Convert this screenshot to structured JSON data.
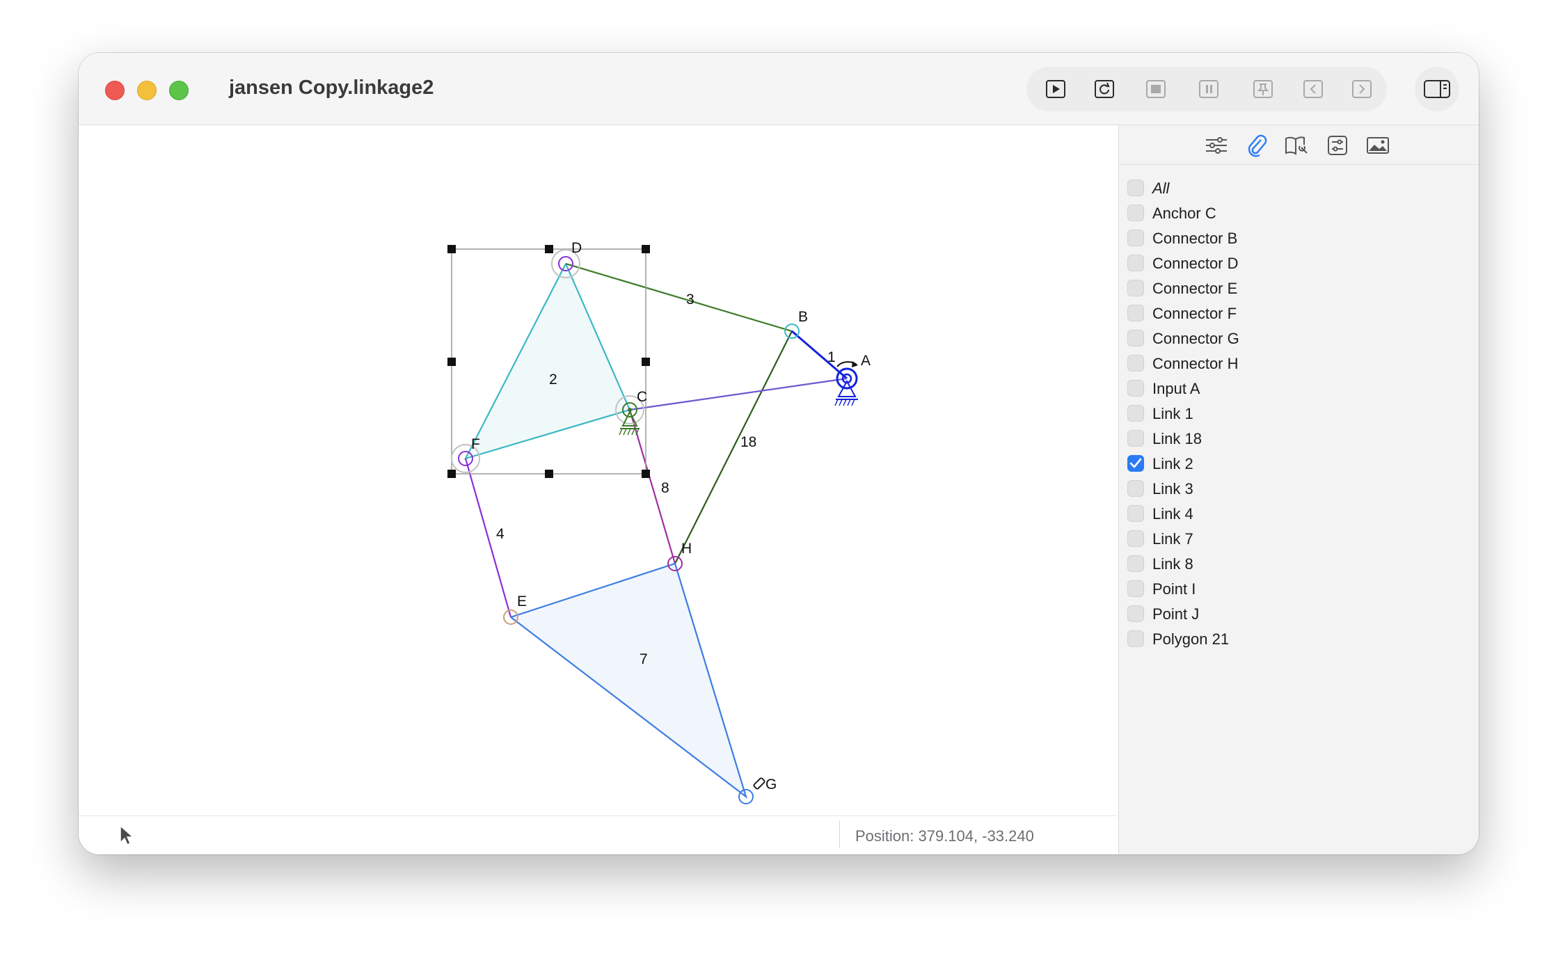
{
  "window": {
    "title": "jansen Copy.linkage2"
  },
  "toolbar": {
    "buttons": [
      {
        "name": "run-button",
        "icon": "play-icon"
      },
      {
        "name": "reset-button",
        "icon": "rotate-icon"
      },
      {
        "name": "stop-button",
        "icon": "stop-icon"
      },
      {
        "name": "pause-button",
        "icon": "pause-icon"
      },
      {
        "name": "pin-button",
        "icon": "pin-icon"
      },
      {
        "name": "step-back-button",
        "icon": "chevron-left-icon"
      },
      {
        "name": "step-forward-button",
        "icon": "chevron-right-icon"
      }
    ],
    "sidebar_toggle_icon": "sidebar-icon"
  },
  "sidebar": {
    "tabs": [
      {
        "name": "properties",
        "icon": "sliders-icon"
      },
      {
        "name": "attachments",
        "icon": "paperclip-icon"
      },
      {
        "name": "manual",
        "icon": "book-wrench-icon"
      },
      {
        "name": "settings",
        "icon": "gear-icon"
      },
      {
        "name": "background-image",
        "icon": "photo-icon"
      }
    ],
    "items": [
      {
        "label": "All",
        "checked": false,
        "italic": true
      },
      {
        "label": "Anchor C",
        "checked": false
      },
      {
        "label": "Connector B",
        "checked": false
      },
      {
        "label": "Connector D",
        "checked": false
      },
      {
        "label": "Connector E",
        "checked": false
      },
      {
        "label": "Connector F",
        "checked": false
      },
      {
        "label": "Connector G",
        "checked": false
      },
      {
        "label": "Connector H",
        "checked": false
      },
      {
        "label": "Input A",
        "checked": false
      },
      {
        "label": "Link 1",
        "checked": false
      },
      {
        "label": "Link 18",
        "checked": false
      },
      {
        "label": "Link 2",
        "checked": true
      },
      {
        "label": "Link 3",
        "checked": false
      },
      {
        "label": "Link 4",
        "checked": false
      },
      {
        "label": "Link 7",
        "checked": false
      },
      {
        "label": "Link 8",
        "checked": false
      },
      {
        "label": "Point I",
        "checked": false
      },
      {
        "label": "Point J",
        "checked": false
      },
      {
        "label": "Polygon 21",
        "checked": false
      }
    ]
  },
  "linkage": {
    "point_labels": {
      "A": "A",
      "B": "B",
      "C": "C",
      "D": "D",
      "E": "E",
      "F": "F",
      "G": "G",
      "H": "H"
    },
    "link_labels": {
      "l1": "1",
      "l2": "2",
      "l3": "3",
      "l4": "4",
      "l7": "7",
      "l8": "8",
      "l18": "18"
    },
    "colors": {
      "link2": "#3cb8c4",
      "link3": "#3a7a28",
      "link18": "#2d5b1e",
      "link1": "#1222dd",
      "linkAC": "#6e56d0",
      "link4": "#8a2fd8",
      "link8": "#a02ea0",
      "link7": "#3b7de0",
      "anchor": "#3a7a28",
      "input": "#1222dd",
      "selection": "#000000"
    }
  },
  "status": {
    "position": "Position: 379.104, -33.240"
  }
}
